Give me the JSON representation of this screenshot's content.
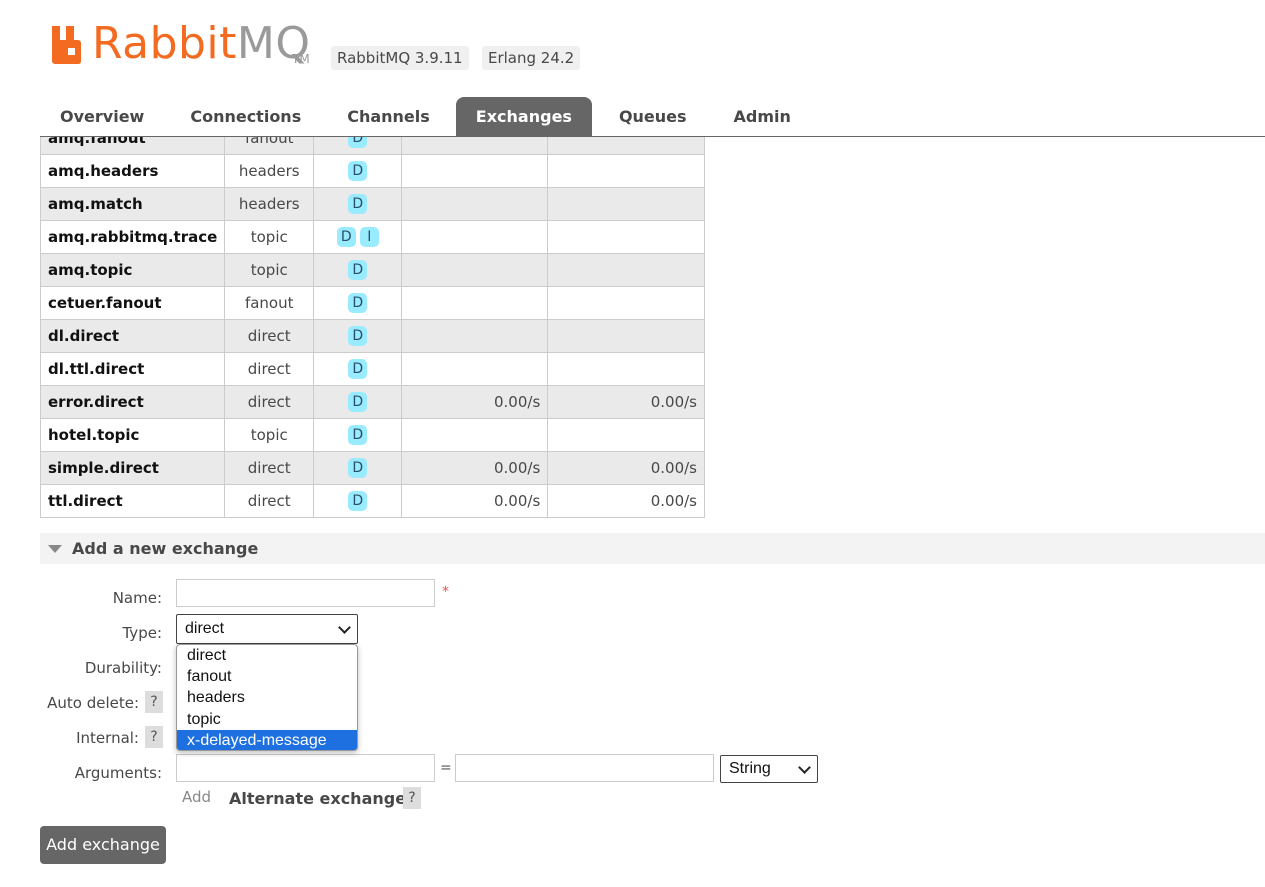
{
  "header": {
    "logo_rabbit": "Rabbit",
    "logo_mq": "MQ",
    "logo_tm": "TM",
    "version": "RabbitMQ 3.9.11",
    "erlang": "Erlang 24.2"
  },
  "tabs": [
    {
      "label": "Overview"
    },
    {
      "label": "Connections"
    },
    {
      "label": "Channels"
    },
    {
      "label": "Exchanges",
      "active": true
    },
    {
      "label": "Queues"
    },
    {
      "label": "Admin"
    }
  ],
  "exchanges": [
    {
      "name": "amq.fanout",
      "type": "fanout",
      "features": [
        "D"
      ],
      "rate_in": "",
      "rate_out": ""
    },
    {
      "name": "amq.headers",
      "type": "headers",
      "features": [
        "D"
      ],
      "rate_in": "",
      "rate_out": ""
    },
    {
      "name": "amq.match",
      "type": "headers",
      "features": [
        "D"
      ],
      "rate_in": "",
      "rate_out": ""
    },
    {
      "name": "amq.rabbitmq.trace",
      "type": "topic",
      "features": [
        "D",
        "I"
      ],
      "rate_in": "",
      "rate_out": ""
    },
    {
      "name": "amq.topic",
      "type": "topic",
      "features": [
        "D"
      ],
      "rate_in": "",
      "rate_out": ""
    },
    {
      "name": "cetuer.fanout",
      "type": "fanout",
      "features": [
        "D"
      ],
      "rate_in": "",
      "rate_out": ""
    },
    {
      "name": "dl.direct",
      "type": "direct",
      "features": [
        "D"
      ],
      "rate_in": "",
      "rate_out": ""
    },
    {
      "name": "dl.ttl.direct",
      "type": "direct",
      "features": [
        "D"
      ],
      "rate_in": "",
      "rate_out": ""
    },
    {
      "name": "error.direct",
      "type": "direct",
      "features": [
        "D"
      ],
      "rate_in": "0.00/s",
      "rate_out": "0.00/s"
    },
    {
      "name": "hotel.topic",
      "type": "topic",
      "features": [
        "D"
      ],
      "rate_in": "",
      "rate_out": ""
    },
    {
      "name": "simple.direct",
      "type": "direct",
      "features": [
        "D"
      ],
      "rate_in": "0.00/s",
      "rate_out": "0.00/s"
    },
    {
      "name": "ttl.direct",
      "type": "direct",
      "features": [
        "D"
      ],
      "rate_in": "0.00/s",
      "rate_out": "0.00/s"
    }
  ],
  "add_section": {
    "title": "Add a new exchange",
    "labels": {
      "name": "Name:",
      "type": "Type:",
      "durability": "Durability:",
      "auto_delete": "Auto delete:",
      "internal": "Internal:",
      "arguments": "Arguments:"
    },
    "help": "?",
    "required_mark": "*",
    "name_value": "",
    "type_selected": "direct",
    "type_options": [
      "direct",
      "fanout",
      "headers",
      "topic",
      "x-delayed-message"
    ],
    "highlighted_option": "x-delayed-message",
    "equals": "=",
    "arg_type_selected": "String",
    "add_link": "Add",
    "alternate_exchange": "Alternate exchange",
    "submit": "Add exchange"
  },
  "colors": {
    "brand_orange": "#f26b21",
    "tab_active": "#666666",
    "feature_badge": "#99ebff",
    "option_highlight": "#1e6fe0"
  }
}
